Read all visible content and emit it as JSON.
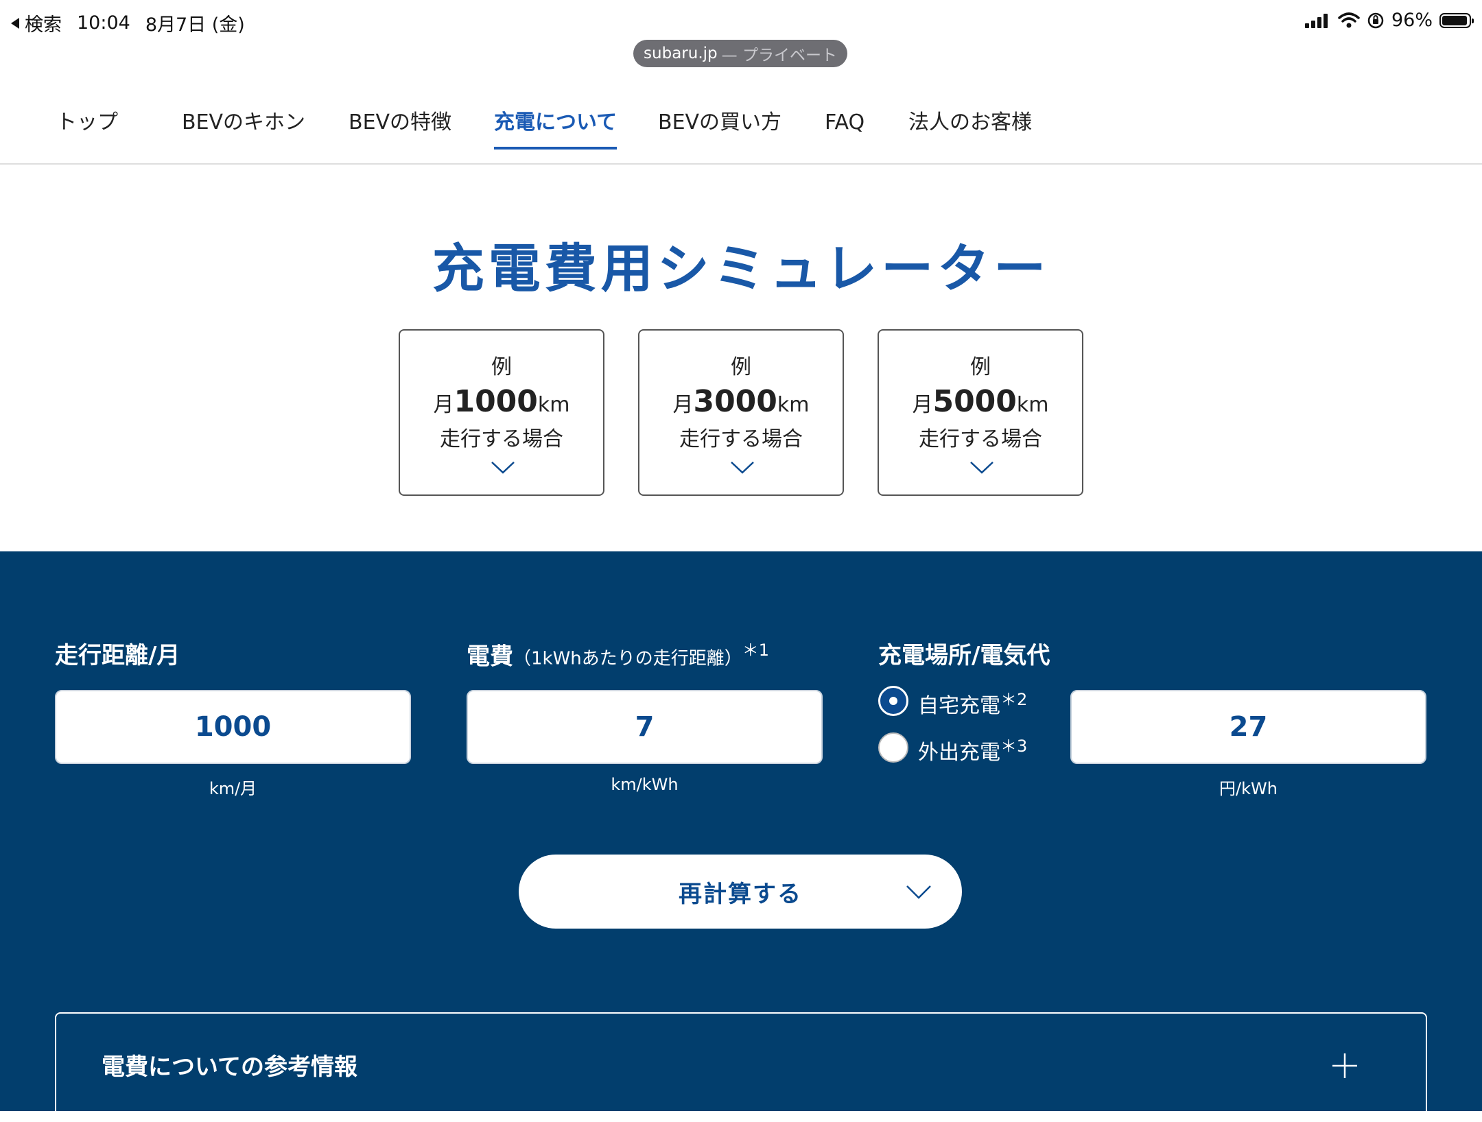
{
  "status_bar": {
    "back_label": "検索",
    "time": "10:04",
    "date": "8月7日 (金)",
    "battery_percent": "96%",
    "battery_level": 0.96,
    "icons": [
      "signal-icon",
      "wifi-icon",
      "orientation-lock-icon",
      "battery-icon"
    ]
  },
  "url_bar": {
    "domain": "subaru.jp",
    "suffix": "— プライベート"
  },
  "nav": {
    "items": [
      {
        "label": "トップ",
        "active": false
      },
      {
        "label": "BEVのキホン",
        "active": false
      },
      {
        "label": "BEVの特徴",
        "active": false
      },
      {
        "label": "充電について",
        "active": true
      },
      {
        "label": "BEVの買い方",
        "active": false
      },
      {
        "label": "FAQ",
        "active": false
      },
      {
        "label": "法人のお客様",
        "active": false
      }
    ]
  },
  "title": "充電費用シミュレーター",
  "examples": [
    {
      "line1": "例",
      "prefix": "月",
      "distance": "1000",
      "unit": "km",
      "line3": "走行する場合"
    },
    {
      "line1": "例",
      "prefix": "月",
      "distance": "3000",
      "unit": "km",
      "line3": "走行する場合"
    },
    {
      "line1": "例",
      "prefix": "月",
      "distance": "5000",
      "unit": "km",
      "line3": "走行する場合"
    }
  ],
  "simulator": {
    "distance": {
      "label": "走行距離/月",
      "value": "1000",
      "unit": "km/月"
    },
    "efficiency": {
      "label": "電費",
      "note": "（1kWhあたりの走行距離）",
      "mark": "＊1",
      "value": "7",
      "unit": "km/kWh"
    },
    "charging": {
      "label": "充電場所/電気代",
      "options": [
        {
          "label": "自宅充電",
          "mark": "＊2",
          "selected": true
        },
        {
          "label": "外出充電",
          "mark": "＊3",
          "selected": false
        }
      ],
      "value": "27",
      "unit": "円/kWh"
    },
    "recalc_label": "再計算する",
    "accordion_title": "電費についての参考情報"
  },
  "colors": {
    "brand_blue": "#1958a7",
    "section_bg": "#023e6d",
    "value_text": "#0b4a8f"
  }
}
